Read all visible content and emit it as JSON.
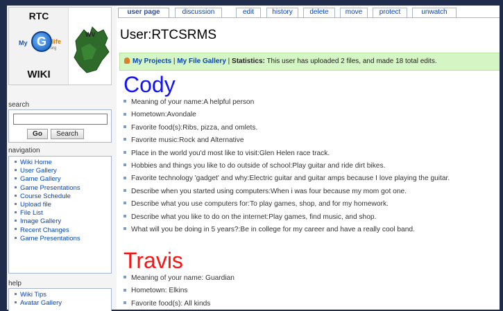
{
  "site": {
    "logo": {
      "line1": "RTC",
      "my": "My",
      "g": "G",
      "life": "life",
      "org": ".org",
      "wv": "WV",
      "line2": "WIKI"
    }
  },
  "sidebar": {
    "search_label": "search",
    "search_placeholder": "",
    "go_label": "Go",
    "search_button_label": "Search",
    "navigation_label": "navigation",
    "navigation_items": [
      "Wiki Home",
      "User Gallery",
      "Game Gallery",
      "Game Presentations",
      "Course Schedule",
      "Upload file",
      "File List",
      "Image Gallery",
      "Recent Changes",
      "Game Presentations"
    ],
    "help_label": "help",
    "help_items": [
      "Wiki Tips",
      "Avatar Gallery"
    ]
  },
  "tabs": [
    "user page",
    "discussion",
    "edit",
    "history",
    "delete",
    "move",
    "protect",
    "unwatch"
  ],
  "page": {
    "title": "User:RTCSRMS",
    "stats": {
      "my_projects": "My Projects",
      "sep1": " | ",
      "my_file_gallery": "My File Gallery",
      "sep2": " | ",
      "statistics_label": "Statistics:",
      "statistics_text": " This user has uploaded 2 files, and made 18 total edits."
    },
    "people": [
      {
        "name": "Cody",
        "facts": [
          "Meaning of your name:A helpful person",
          "Hometown:Avondale",
          "Favorite food(s):Ribs, pizza, and omlets.",
          "Favorite music:Rock and Alternative",
          "Place in the world you'd most like to visit:Glen Helen race track.",
          "Hobbies and things you like to do outside of school:Play guitar and ride dirt bikes.",
          "Favorite technology 'gadget' and why:Electric guitar and guitar amps because I love playing the guitar.",
          "Describe when you started using computers:When i was four because my mom got one.",
          "Describe what you use computers for:To play games, shop, and for my homework.",
          "Describe what you like to do on the internet:Play games, find music, and shop.",
          "What will you be doing in 5 years?:Be in college for my career and have a really cool band."
        ]
      },
      {
        "name": "Travis",
        "facts": [
          "Meaning of your name: Guardian",
          "Hometown: Elkins",
          "Favorite food(s): All kinds"
        ]
      }
    ]
  },
  "colors": {
    "frame": "#1f2c4c",
    "link": "#0645ad",
    "stats_bg": "#d6f5c4",
    "name_cody": "#1111ff",
    "name_travis": "#ff1111"
  }
}
